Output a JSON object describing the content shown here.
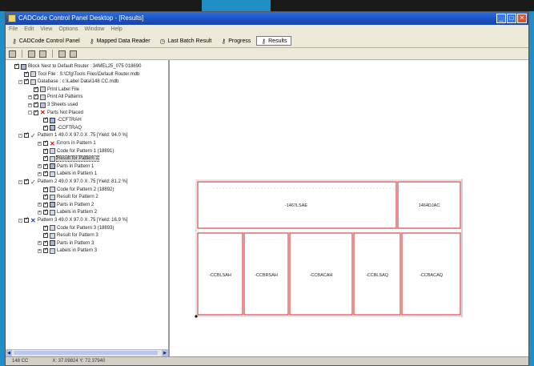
{
  "window": {
    "title": "CADCode Control Panel Desktop - [Results]"
  },
  "menu": [
    "File",
    "Edit",
    "View",
    "Options",
    "Window",
    "Help"
  ],
  "tabs": [
    {
      "label": "CADCode Control Panel",
      "active": false,
      "icon": "key-icon"
    },
    {
      "label": "Mapped Data Reader",
      "active": false,
      "icon": "key-icon"
    },
    {
      "label": "Last Batch Result",
      "active": false,
      "icon": "clock-icon"
    },
    {
      "label": "Progress",
      "active": false,
      "icon": "key-icon"
    },
    {
      "label": "Results",
      "active": true,
      "icon": "key-icon"
    }
  ],
  "tree": [
    {
      "text": "Block Nest to Default Router : 34MEL25_075 018690",
      "level": 0,
      "icon": "part",
      "exp": ""
    },
    {
      "text": "Tool File : S:\\Cfg\\Tools Files\\Default Router.mdb",
      "level": 1,
      "icon": "gear",
      "exp": ""
    },
    {
      "text": "Database : c:\\Label Data\\148 CC.mdb",
      "level": 1,
      "icon": "db",
      "exp": "-"
    },
    {
      "text": "Print Label File",
      "level": 2,
      "icon": "print",
      "exp": ""
    },
    {
      "text": "Print All Patterns",
      "level": 2,
      "icon": "print",
      "exp": "+"
    },
    {
      "text": "3 Sheets used",
      "level": 2,
      "icon": "sheet",
      "exp": "+"
    },
    {
      "text": "Parts Not Placed",
      "level": 2,
      "icon": "red",
      "exp": "-"
    },
    {
      "text": "-CCFTRAH",
      "level": 3,
      "icon": "part",
      "exp": ""
    },
    {
      "text": "-CCFTRAQ",
      "level": 3,
      "icon": "part",
      "exp": ""
    },
    {
      "text": "Pattern 1    49.0 X 97.0 X .75  [Yield: 94.0 %]",
      "level": 1,
      "icon": "ok",
      "exp": "-"
    },
    {
      "text": "Errors in Pattern 1",
      "level": 3,
      "icon": "red",
      "exp": "+"
    },
    {
      "text": "Code for Pattern 1 (18891)",
      "level": 3,
      "icon": "doc",
      "exp": ""
    },
    {
      "text": "Result for Pattern 1",
      "level": 3,
      "icon": "doc",
      "exp": "",
      "selected": true
    },
    {
      "text": "Parts in Pattern 1",
      "level": 3,
      "icon": "part",
      "exp": "+"
    },
    {
      "text": "Labels in Pattern 1",
      "level": 3,
      "icon": "label",
      "exp": "+"
    },
    {
      "text": "Pattern 2    49.0 X 97.0 X .75  [Yield: 81.2 %]",
      "level": 1,
      "icon": "ok",
      "exp": "-"
    },
    {
      "text": "Code for Pattern 2 (18892)",
      "level": 3,
      "icon": "doc",
      "exp": ""
    },
    {
      "text": "Result for Pattern 2",
      "level": 3,
      "icon": "doc",
      "exp": ""
    },
    {
      "text": "Parts in Pattern 2",
      "level": 3,
      "icon": "part",
      "exp": "+"
    },
    {
      "text": "Labels in Pattern 2",
      "level": 3,
      "icon": "label",
      "exp": "+"
    },
    {
      "text": "Pattern 3    49.0 X 97.0 X .75  [Yield: 16.9 %]",
      "level": 1,
      "icon": "blue",
      "exp": "-"
    },
    {
      "text": "Code for Pattern 3 (18893)",
      "level": 3,
      "icon": "doc",
      "exp": ""
    },
    {
      "text": "Result for Pattern 3",
      "level": 3,
      "icon": "doc",
      "exp": ""
    },
    {
      "text": "Parts in Pattern 3",
      "level": 3,
      "icon": "part",
      "exp": "+"
    },
    {
      "text": "Labels in Pattern 3",
      "level": 3,
      "icon": "label",
      "exp": "+"
    }
  ],
  "parts": {
    "top_left": "-1467LSAE",
    "top_right": "1464DJAC",
    "bottom": [
      "-CCBLSAH",
      "-CCBRSAH",
      "-CCBACAH",
      "-CCBLSAQ",
      "-CCBACAQ"
    ]
  },
  "status": {
    "left": "148 CC",
    "coords": "X: 37.09824  Y: 72.37940"
  },
  "colors": {
    "part_line": "#d84848",
    "accent": "#2b6fe0"
  }
}
